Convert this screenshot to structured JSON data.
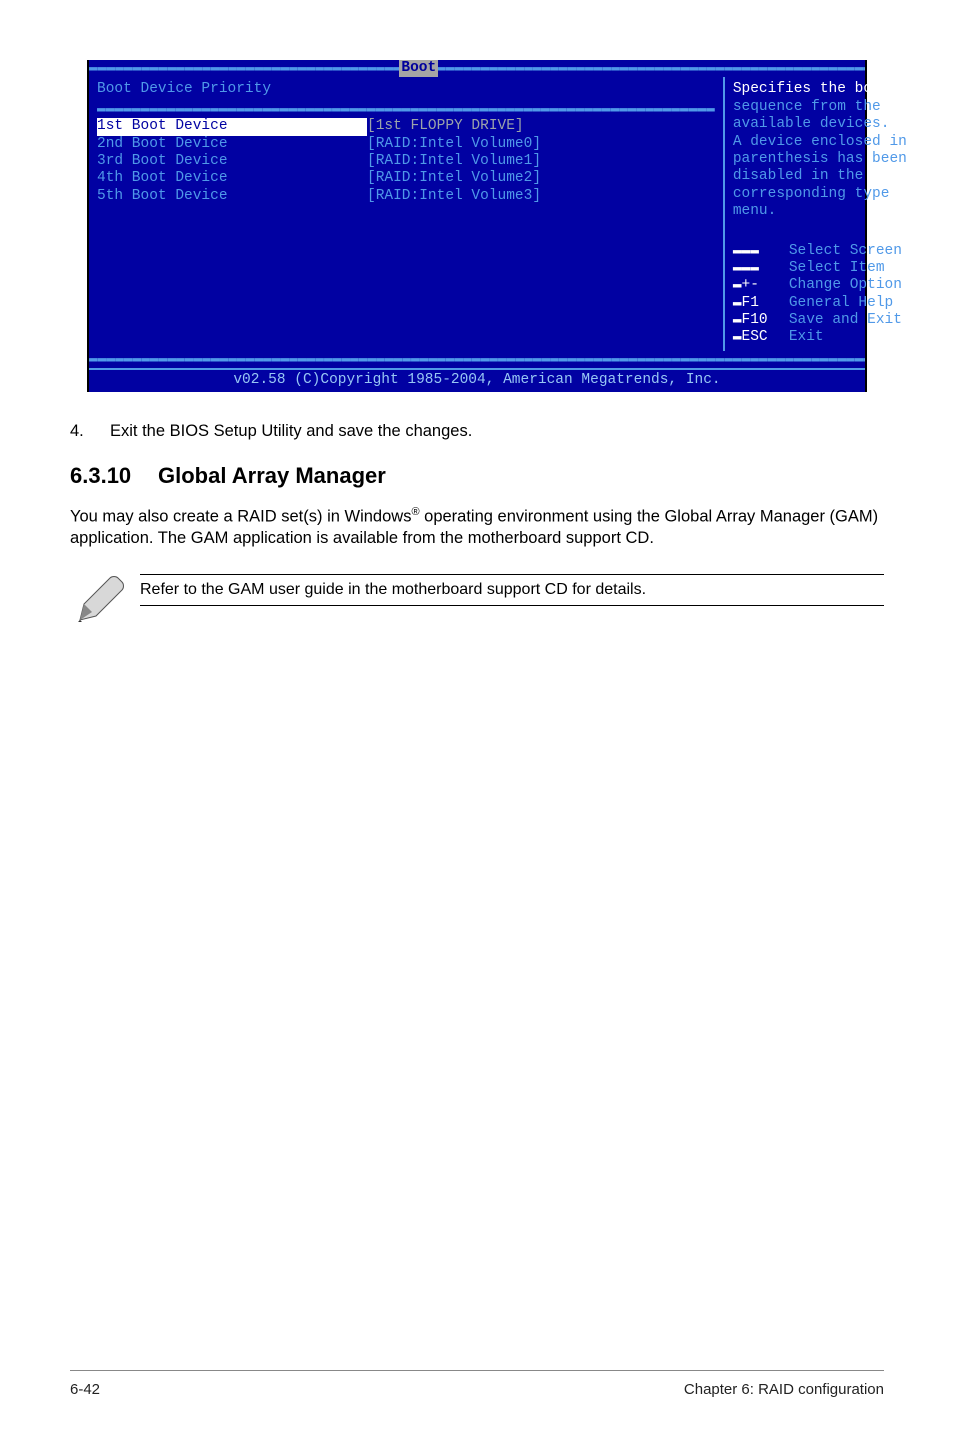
{
  "bios": {
    "titlebar": "Boot",
    "heading": "Boot Device Priority",
    "sep_top": "▬▬▬▬▬▬▬▬▬▬▬▬▬▬▬▬▬▬▬▬▬▬▬▬▬▬▬▬▬▬▬▬▬▬▬▬▬▬▬▬▬▬▬▬▬▬▬▬▬▬▬▬▬▬▬▬▬▬▬▬▬▬▬▬▬▬▬▬▬▬▬▬▬▬▬▬▬▬▬▬▬▬▬▬▬▬▬▬▬▬▬▬▬",
    "sep_heading": "▬▬▬▬▬▬▬▬▬▬▬▬▬▬▬▬▬▬▬▬▬▬▬▬▬▬▬▬▬▬▬▬▬▬▬▬▬▬▬▬▬▬▬▬▬▬▬▬▬▬▬▬▬▬▬▬▬▬▬▬▬▬▬▬▬▬▬▬▬▬▬",
    "rows": [
      {
        "label": "1st Boot Device",
        "value": "[1st FLOPPY DRIVE]",
        "selected": true
      },
      {
        "label": "2nd Boot Device",
        "value": "[RAID:Intel Volume0]",
        "selected": false
      },
      {
        "label": "3rd Boot Device",
        "value": "[RAID:Intel Volume1]",
        "selected": false
      },
      {
        "label": "4th Boot Device",
        "value": "[RAID:Intel Volume2]",
        "selected": false
      },
      {
        "label": "5th Boot Device",
        "value": "[RAID:Intel Volume3]",
        "selected": false
      }
    ],
    "help": [
      "Specifies the boot",
      "sequence from the",
      "available devices.",
      "",
      "A device enclosed in",
      "parenthesis has been",
      "disabled in the",
      "corresponding type",
      "menu."
    ],
    "keys": [
      {
        "k": "▬▬▬",
        "d": "Select Screen"
      },
      {
        "k": "▬▬▬",
        "d": "Select Item"
      },
      {
        "k": "▬+-",
        "d": "Change Option"
      },
      {
        "k": "▬F1",
        "d": "General Help"
      },
      {
        "k": "▬F10",
        "d": "Save and Exit"
      },
      {
        "k": "▬ESC",
        "d": "Exit"
      }
    ],
    "sep_bottom": "▬▬▬▬▬▬▬▬▬▬▬▬▬▬▬▬▬▬▬▬▬▬▬▬▬▬▬▬▬▬▬▬▬▬▬▬▬▬▬▬▬▬▬▬▬▬▬▬▬▬▬▬▬▬▬▬▬▬▬▬▬▬▬▬▬▬▬▬▬▬▬▬▬▬▬▬▬▬▬▬▬▬▬▬▬▬▬▬▬▬▬▬▬",
    "footer": "v02.58 (C)Copyright 1985-2004, American Megatrends, Inc."
  },
  "step": {
    "num": "4.",
    "text": "Exit the BIOS Setup Utility and save the changes."
  },
  "section": {
    "num": "6.3.10",
    "title": "Global Array Manager"
  },
  "body_parts": {
    "a": "You may also create a RAID set(s) in Windows",
    "sup": "®",
    "b": " operating environment using the Global Array Manager (GAM) application. The GAM application is available from the motherboard support CD."
  },
  "note": "Refer to the GAM user guide in the motherboard support CD for details.",
  "footer": {
    "left": "6-42",
    "right": "Chapter 6: RAID configuration"
  }
}
